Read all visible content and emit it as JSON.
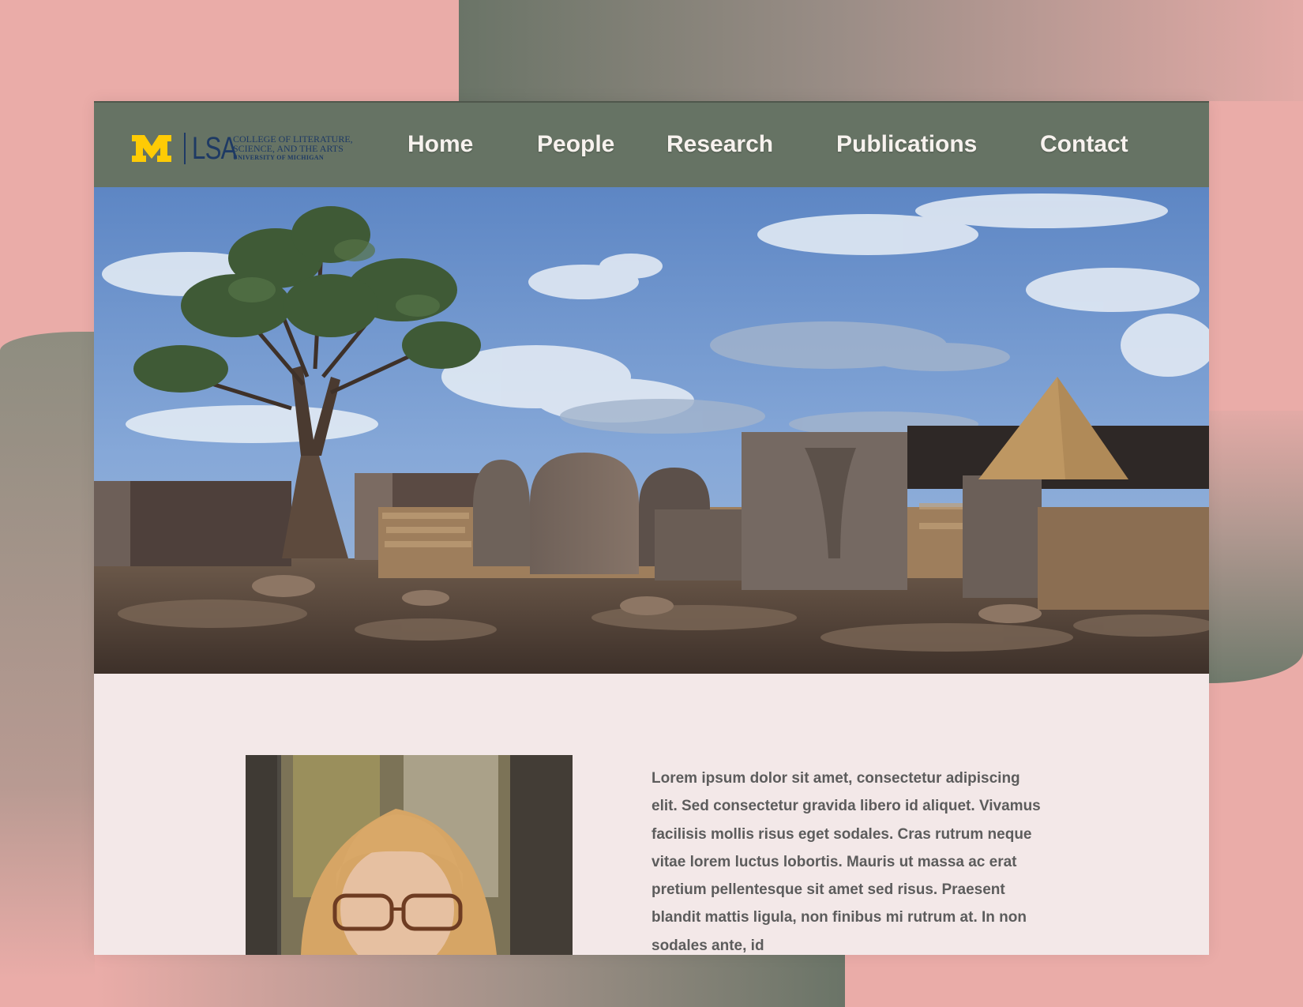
{
  "header": {
    "logo": {
      "monogram": "M",
      "unit": "LSA",
      "line1": "COLLEGE OF LITERATURE,",
      "line2": "SCIENCE, AND THE ARTS",
      "line3": "UNIVERSITY OF MICHIGAN"
    },
    "nav": [
      "Home",
      "People",
      "Research",
      "Publications",
      "Contact"
    ]
  },
  "hero": {
    "scene": "village-with-baobab-tree-photo"
  },
  "main": {
    "portrait": "woman-with-glasses-portrait-photo",
    "body_text": "Lorem ipsum dolor sit amet, consectetur adipiscing elit. Sed consectetur gravida libero id aliquet. Vivamus facilisis mollis risus eget sodales. Cras rutrum neque vitae lorem luctus lobortis. Mauris ut massa ac erat pretium pellentesque sit amet sed risus. Praesent blandit mattis ligula, non finibus mi rutrum at. In non sodales ante, id"
  },
  "colors": {
    "page_background": "#eaaca8",
    "navbar": "#667364",
    "content_background": "#f3e8e8",
    "michigan_maize": "#ffcb05",
    "michigan_blue": "#1e3a64"
  }
}
